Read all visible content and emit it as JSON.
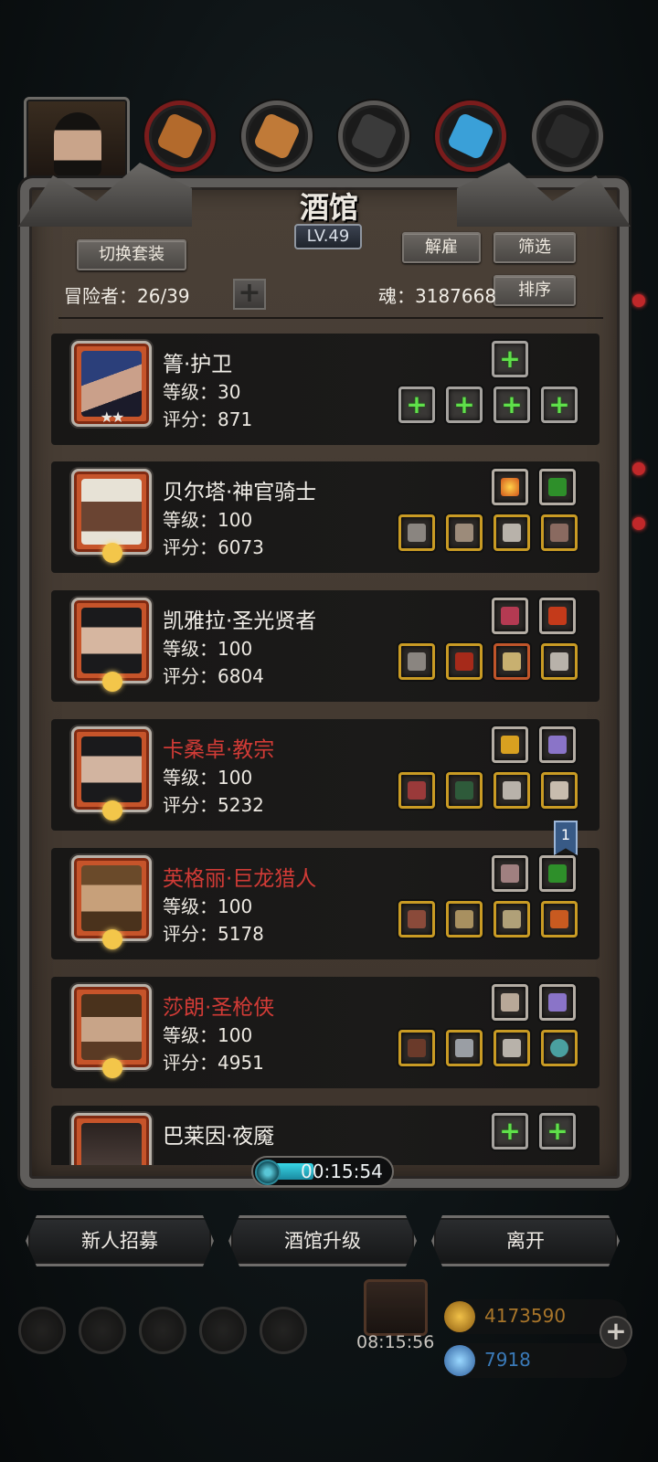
{
  "header": {
    "title": "酒馆",
    "level": "LV.49"
  },
  "toolbar": {
    "switch_outfit": "切换套装",
    "dismiss": "解雇",
    "filter": "筛选",
    "sort": "排序",
    "add": "+"
  },
  "stats": {
    "adventurers_label": "冒险者：26/39",
    "soul_label": "魂：3187668"
  },
  "heroes": [
    {
      "name": "箐·护卫",
      "level": "等级：30",
      "score": "评分：871",
      "stars": "★★",
      "name_color": "white"
    },
    {
      "name": "贝尔塔·神官骑士",
      "level": "等级：100",
      "score": "评分：6073",
      "name_color": "white"
    },
    {
      "name": "凯雅拉·圣光贤者",
      "level": "等级：100",
      "score": "评分：6804",
      "name_color": "white"
    },
    {
      "name": "卡桑卓·教宗",
      "level": "等级：100",
      "score": "评分：5232",
      "name_color": "red"
    },
    {
      "name": "英格丽·巨龙猎人",
      "level": "等级：100",
      "score": "评分：5178",
      "name_color": "red"
    },
    {
      "name": "莎朗·圣枪侠",
      "level": "等级：100",
      "score": "评分：4951",
      "name_color": "red"
    },
    {
      "name": "巴莱因·夜魇",
      "level": "",
      "score": "",
      "name_color": "white"
    }
  ],
  "bookmark": "1",
  "timer": "00:15:54",
  "actions": {
    "recruit": "新人招募",
    "upgrade": "酒馆升级",
    "leave": "离开"
  },
  "chest_timer": "08:15:56",
  "currency": {
    "gold": "4173590",
    "gems": "7918",
    "add": "+"
  },
  "colors": {
    "accent_red": "#d13b36",
    "plus_green": "#5fe04a",
    "frame_gray": "#5f5d5b"
  }
}
